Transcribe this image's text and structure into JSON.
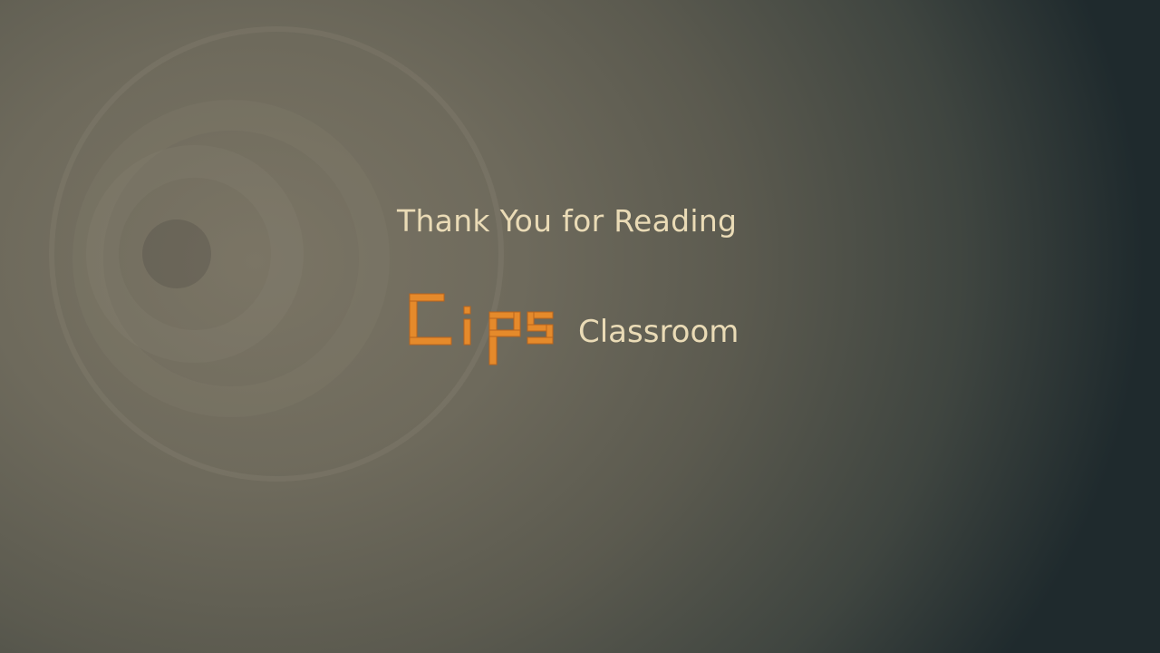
{
  "slide": {
    "heading": "Thank You for Reading",
    "logo": {
      "wordmark": "Cips",
      "wordmark_color": "#e58a2b",
      "suffix": "Classroom"
    },
    "text_color": "#eadbb6"
  }
}
